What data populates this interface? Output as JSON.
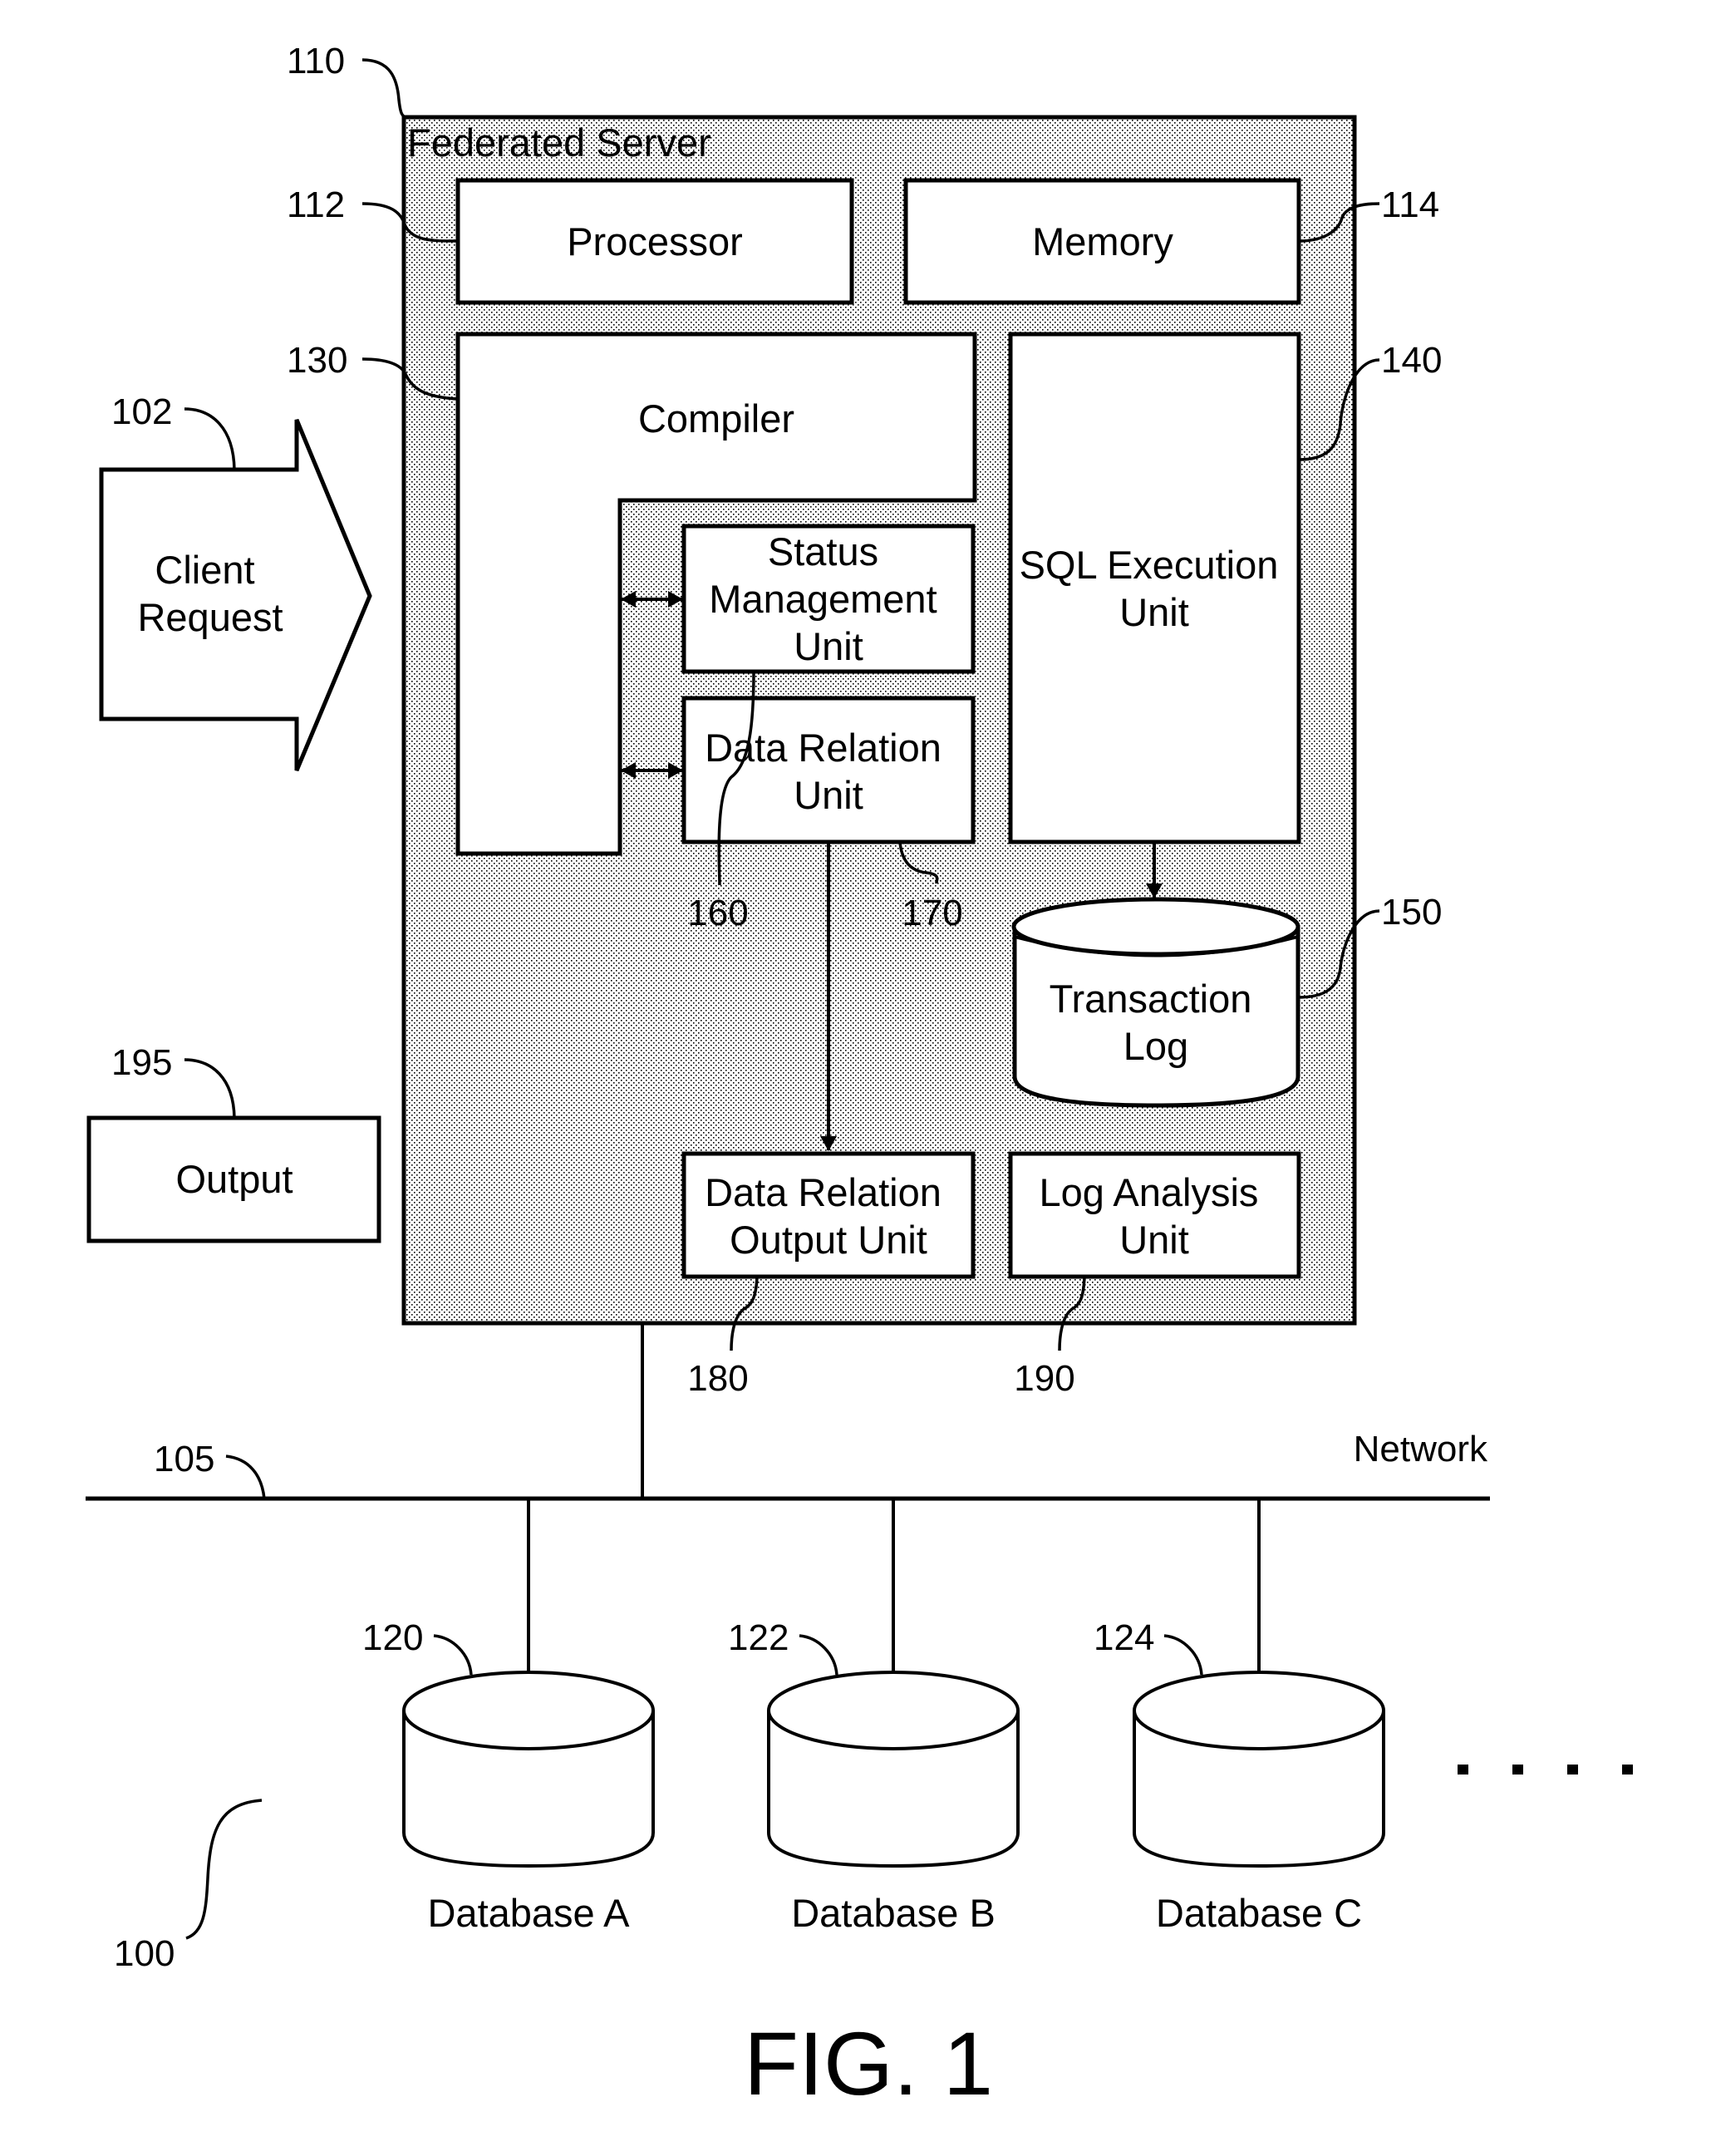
{
  "figure": {
    "caption": "FIG. 1",
    "system_ref": "100"
  },
  "federated_server": {
    "title": "Federated Server",
    "ref": "110",
    "components": {
      "processor": {
        "label": "Processor",
        "ref": "112"
      },
      "memory": {
        "label": "Memory",
        "ref": "114"
      },
      "compiler": {
        "label": "Compiler",
        "ref": "130"
      },
      "sql_execution_unit": {
        "lines": [
          "SQL Execution",
          "Unit"
        ],
        "ref": "140"
      },
      "transaction_log": {
        "lines": [
          "Transaction",
          "Log"
        ],
        "ref": "150"
      },
      "status_management_unit": {
        "lines": [
          "Status",
          "Management",
          "Unit"
        ],
        "ref": "160"
      },
      "data_relation_unit": {
        "lines": [
          "Data Relation",
          "Unit"
        ],
        "ref": "170"
      },
      "data_relation_output_unit": {
        "lines": [
          "Data Relation",
          "Output Unit"
        ],
        "ref": "180"
      },
      "log_analysis_unit": {
        "lines": [
          "Log Analysis",
          "Unit"
        ],
        "ref": "190"
      }
    }
  },
  "client_request": {
    "lines": [
      "Client",
      "Request"
    ],
    "ref": "102"
  },
  "output": {
    "label": "Output",
    "ref": "195"
  },
  "network": {
    "label": "Network",
    "ref": "105"
  },
  "databases": [
    {
      "label": "Database A",
      "ref": "120"
    },
    {
      "label": "Database B",
      "ref": "122"
    },
    {
      "label": "Database C",
      "ref": "124"
    }
  ],
  "continuation": "· · · ·",
  "colors": {
    "stroke": "#000000",
    "background": "#ffffff",
    "stipple_dot": "#000000"
  }
}
